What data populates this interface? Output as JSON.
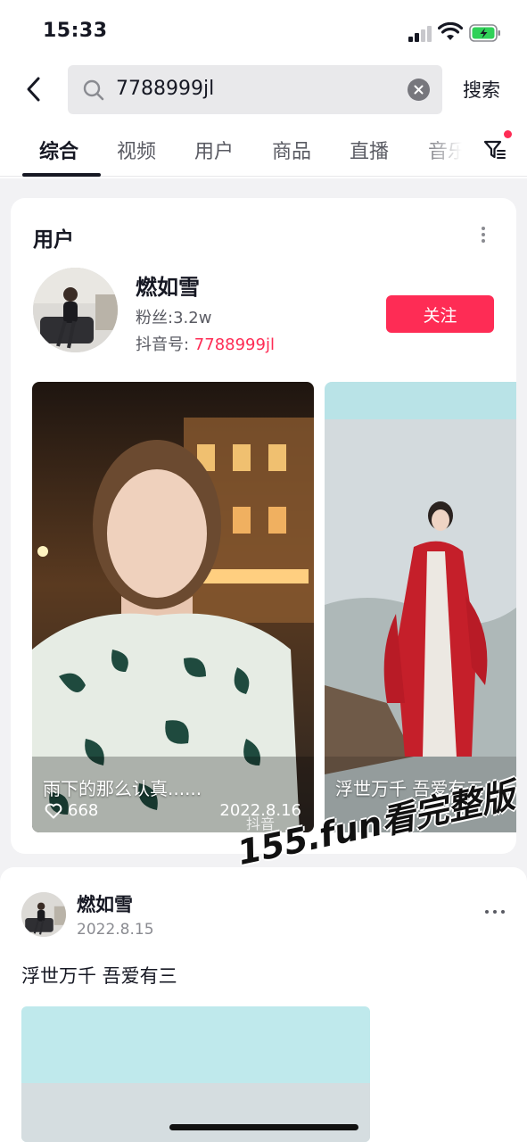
{
  "status_bar": {
    "time": "15:33"
  },
  "search": {
    "query": "7788999jl",
    "submit_label": "搜索"
  },
  "tabs": [
    {
      "label": "综合",
      "active": true
    },
    {
      "label": "视频"
    },
    {
      "label": "用户"
    },
    {
      "label": "商品"
    },
    {
      "label": "直播"
    },
    {
      "label": "音乐"
    }
  ],
  "user_card": {
    "section_title": "用户",
    "name": "燃如雪",
    "fans": "粉丝:3.2w",
    "id_label": "抖音号: ",
    "id_value": "7788999jl",
    "follow_label": "关注",
    "videos": [
      {
        "title": "雨下的那么认真......",
        "likes": "668",
        "date": "2022.8.16",
        "watermark": "抖音"
      },
      {
        "title": "浮世万千 吾爱有三"
      }
    ]
  },
  "overlay_watermark": "155.fun看完整版",
  "post": {
    "author": "燃如雪",
    "date": "2022.8.15",
    "text": "浮世万千 吾爱有三"
  },
  "colors": {
    "accent": "#fe2c55",
    "text": "#161823",
    "secondary": "#5a5b63"
  }
}
